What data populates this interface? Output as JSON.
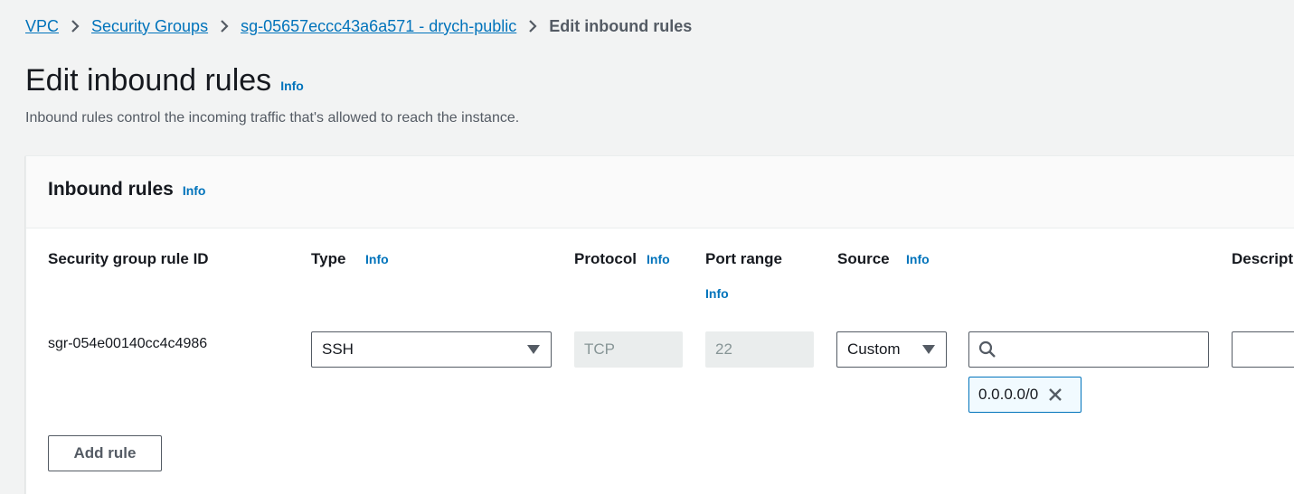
{
  "breadcrumb": {
    "items": [
      "VPC",
      "Security Groups",
      "sg-05657eccc43a6a571 - drych-public"
    ],
    "current": "Edit inbound rules"
  },
  "page": {
    "title": "Edit inbound rules",
    "info": "Info",
    "description": "Inbound rules control the incoming traffic that's allowed to reach the instance."
  },
  "panel": {
    "title": "Inbound rules",
    "info": "Info"
  },
  "columns": {
    "rule_id": "Security group rule ID",
    "type": "Type",
    "type_info": "Info",
    "protocol": "Protocol",
    "protocol_info": "Info",
    "port_range": "Port range",
    "port_info": "Info",
    "source": "Source",
    "source_info": "Info",
    "description": "Descripti"
  },
  "rules": [
    {
      "rule_id": "sgr-054e00140cc4c4986",
      "type": "SSH",
      "protocol": "TCP",
      "port_range": "22",
      "source_type": "Custom",
      "source_search_value": "",
      "source_tokens": [
        "0.0.0.0/0"
      ],
      "description": ""
    }
  ],
  "actions": {
    "add_rule": "Add rule"
  },
  "colors": {
    "link": "#0073bb",
    "background": "#f2f3f3",
    "text": "#16191f",
    "muted": "#545b64",
    "disabled_bg": "#eaeded",
    "token_bg": "#f1faff"
  }
}
